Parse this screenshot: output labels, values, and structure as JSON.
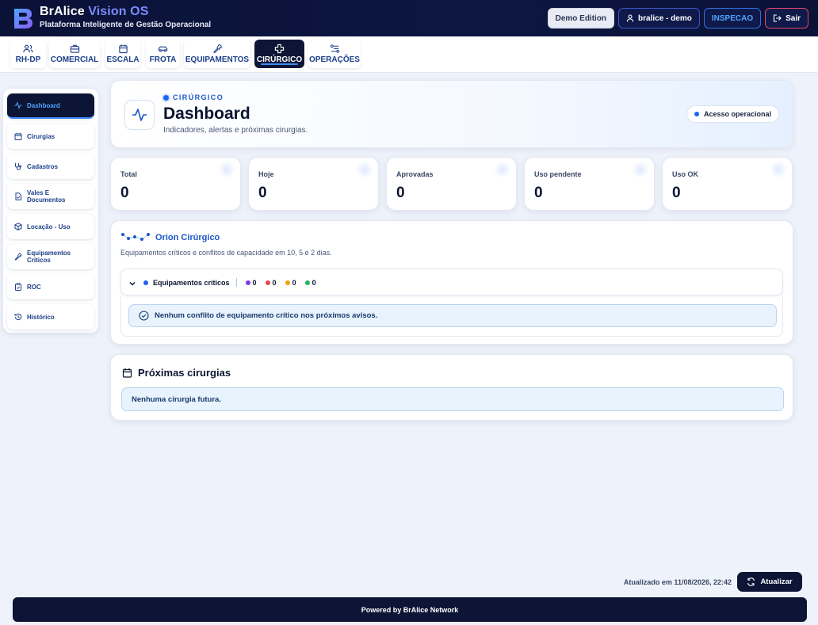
{
  "app": {
    "name_main": "BrAlice",
    "name_accent": "Vision OS",
    "subtitle": "Plataforma Inteligente de Gestão Operacional"
  },
  "header_buttons": {
    "demo": "Demo Edition",
    "user": "bralice - demo",
    "role": "INSPECAO",
    "logout": "Sair"
  },
  "modules": [
    {
      "label": "RH-DP",
      "icon": "users-icon"
    },
    {
      "label": "COMERCIAL",
      "icon": "briefcase-icon"
    },
    {
      "label": "ESCALA",
      "icon": "calendar-icon"
    },
    {
      "label": "FROTA",
      "icon": "car-icon"
    },
    {
      "label": "EQUIPAMENTOS",
      "icon": "wrench-icon"
    },
    {
      "label": "CIRÚRGICO",
      "icon": "medical-cross-icon",
      "active": true
    },
    {
      "label": "OPERAÇÕES",
      "icon": "workflow-icon"
    }
  ],
  "sidebar": {
    "items": [
      {
        "label": "Dashboard",
        "icon": "activity-icon",
        "active": true
      },
      {
        "label": "Cirurgias",
        "icon": "calendar-icon"
      },
      {
        "label": "Cadastros",
        "icon": "stethoscope-icon"
      },
      {
        "label": "Vales E Documentos",
        "icon": "document-check-icon"
      },
      {
        "label": "Locação - Uso",
        "icon": "box-icon"
      },
      {
        "label": "Equipamentos Críticos",
        "icon": "wrench-icon"
      },
      {
        "label": "ROC",
        "icon": "clipboard-icon"
      },
      {
        "label": "Histórico",
        "icon": "history-icon"
      }
    ]
  },
  "hero": {
    "kicker": "CIRÚRGICO",
    "title": "Dashboard",
    "subtitle": "Indicadores, alertas e próximas cirurgias.",
    "badge": "Acesso operacional"
  },
  "stats": [
    {
      "label": "Total",
      "value": "0"
    },
    {
      "label": "Hoje",
      "value": "0"
    },
    {
      "label": "Aprovadas",
      "value": "0"
    },
    {
      "label": "Uso pendente",
      "value": "0"
    },
    {
      "label": "Uso OK",
      "value": "0"
    }
  ],
  "orion": {
    "title": "Orion Cirúrgico",
    "subtitle": "Equipamentos críticos e conflitos de capacidade em 10, 5 e 2 dias.",
    "accordion_label": "Equipamentos críticos",
    "counters": [
      {
        "value": "0",
        "color": "#7c3aed"
      },
      {
        "value": "0",
        "color": "#e5484d"
      },
      {
        "value": "0",
        "color": "#f59e0b"
      },
      {
        "value": "0",
        "color": "#22b35e"
      }
    ],
    "notice": "Nenhum conflito de equipamento crítico nos próximos avisos."
  },
  "upcoming": {
    "title": "Próximas cirurgias",
    "notice": "Nenhuma cirurgia futura."
  },
  "footer": {
    "updated": "Atualizado em 11/08/2026, 22:42",
    "refresh": "Atualizar",
    "powered": "Powered by BrAlice Network"
  },
  "colors": {
    "navy": "#0c1535",
    "accent": "#1c58c8",
    "background": "#eef2fa"
  }
}
